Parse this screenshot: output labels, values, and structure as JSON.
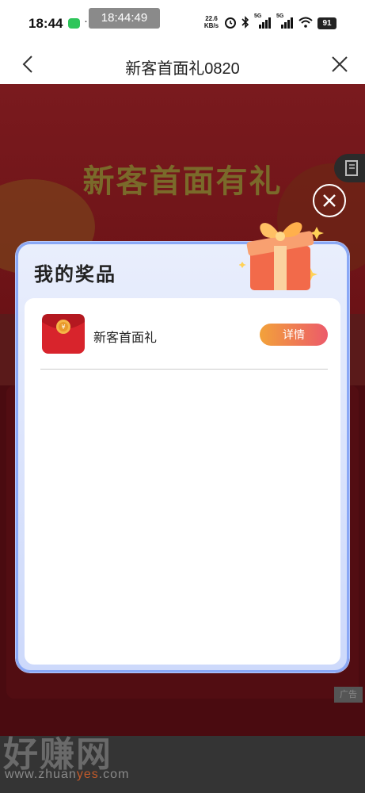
{
  "status_bar": {
    "time": "18:44",
    "overlay_time": "18:44:49",
    "network_speed_value": "22.6",
    "network_speed_unit": "KB/s",
    "signal_1": "5G",
    "signal_2": "5G",
    "battery": "91"
  },
  "nav": {
    "title": "新客首面礼0820"
  },
  "page": {
    "banner_title": "新客首面有礼",
    "ad_label": "广告"
  },
  "modal": {
    "title": "我的奖品",
    "prizes": [
      {
        "name": "新客首面礼",
        "detail_label": "详情"
      }
    ]
  },
  "watermark": {
    "main": "好赚网",
    "sub_1": "www.zhuan",
    "sub_2": "yes",
    "sub_3": ".com"
  },
  "colors": {
    "accent_gradient_start": "#f2a23a",
    "accent_gradient_end": "#ec5a6a",
    "modal_border": "#8aa8f6"
  }
}
